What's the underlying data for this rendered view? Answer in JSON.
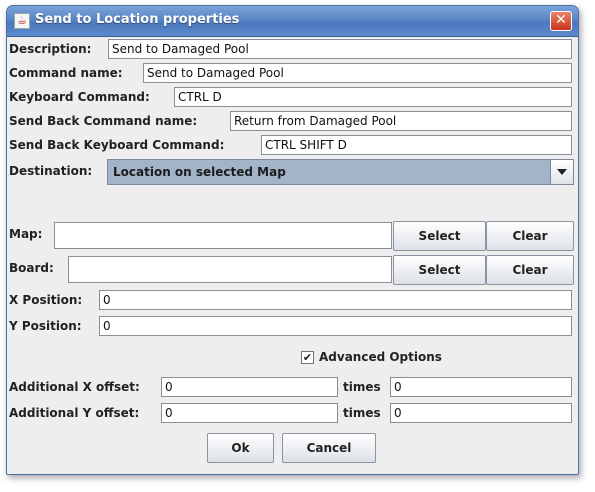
{
  "window": {
    "title": "Send to Location properties"
  },
  "fields": {
    "description": {
      "label": "Description:",
      "value": "Send to Damaged Pool"
    },
    "command_name": {
      "label": "Command name:",
      "value": "Send to Damaged Pool"
    },
    "keyboard_command": {
      "label": "Keyboard Command:",
      "value": "CTRL D"
    },
    "send_back_command_name": {
      "label": "Send Back Command name:",
      "value": "Return from Damaged Pool"
    },
    "send_back_keyboard_command": {
      "label": "Send Back Keyboard Command:",
      "value": "CTRL SHIFT D"
    },
    "destination": {
      "label": "Destination:",
      "value": "Location on selected Map"
    },
    "map": {
      "label": "Map:",
      "value": "",
      "select_label": "Select",
      "clear_label": "Clear"
    },
    "board": {
      "label": "Board:",
      "value": "",
      "select_label": "Select",
      "clear_label": "Clear"
    },
    "x_position": {
      "label": "X Position:",
      "value": "0"
    },
    "y_position": {
      "label": "Y Position:",
      "value": "0"
    },
    "advanced_options": {
      "label": "Advanced Options",
      "checked": true,
      "check_glyph": "✔"
    },
    "additional_x": {
      "label": "Additional X offset:",
      "value": "0",
      "times_label": "times",
      "times_value": "0"
    },
    "additional_y": {
      "label": "Additional Y offset:",
      "value": "0",
      "times_label": "times",
      "times_value": "0"
    }
  },
  "buttons": {
    "ok": "Ok",
    "cancel": "Cancel"
  },
  "colors": {
    "titlebar": "#5a86c6",
    "close": "#c8361c",
    "combo_bg": "#a2b4c8",
    "dialog_bg": "#eeeeee"
  }
}
